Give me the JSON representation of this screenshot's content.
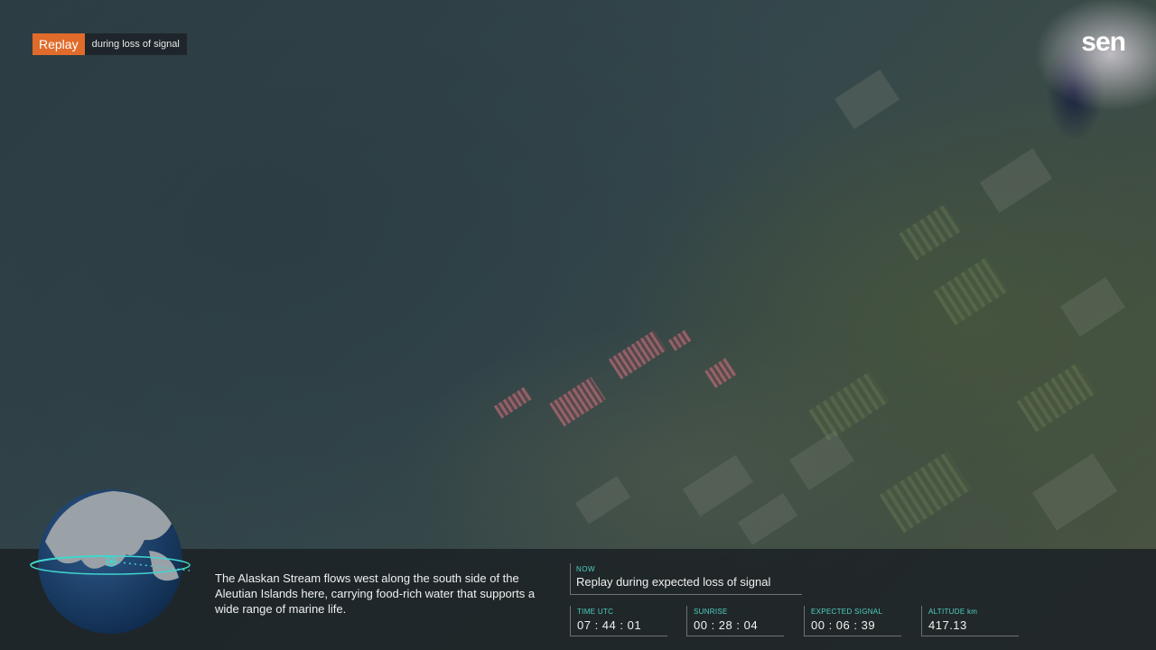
{
  "replay": {
    "badge": "Replay",
    "note": "during loss of signal"
  },
  "brand": {
    "logo": "sen"
  },
  "description": "The Alaskan Stream flows west along the south side of the Aleutian Islands here, carrying food-rich water that supports a wide range of marine life.",
  "now": {
    "label": "NOW",
    "value": "Replay during expected loss of signal"
  },
  "stats": [
    {
      "label": "TIME UTC",
      "value": "07 : 44 : 01"
    },
    {
      "label": "SUNRISE",
      "value": "00 : 28 : 04"
    },
    {
      "label": "EXPECTED SIGNAL",
      "value": "00 : 06 : 39"
    },
    {
      "label": "ALTITUDE km",
      "value": "417.13"
    }
  ],
  "colors": {
    "accent": "#e06b2a",
    "label_teal": "#4fd0c2",
    "orbit": "#3fd6d0"
  },
  "icons": {
    "globe": "globe-icon",
    "orbit_marker": "orbit-position-icon"
  }
}
